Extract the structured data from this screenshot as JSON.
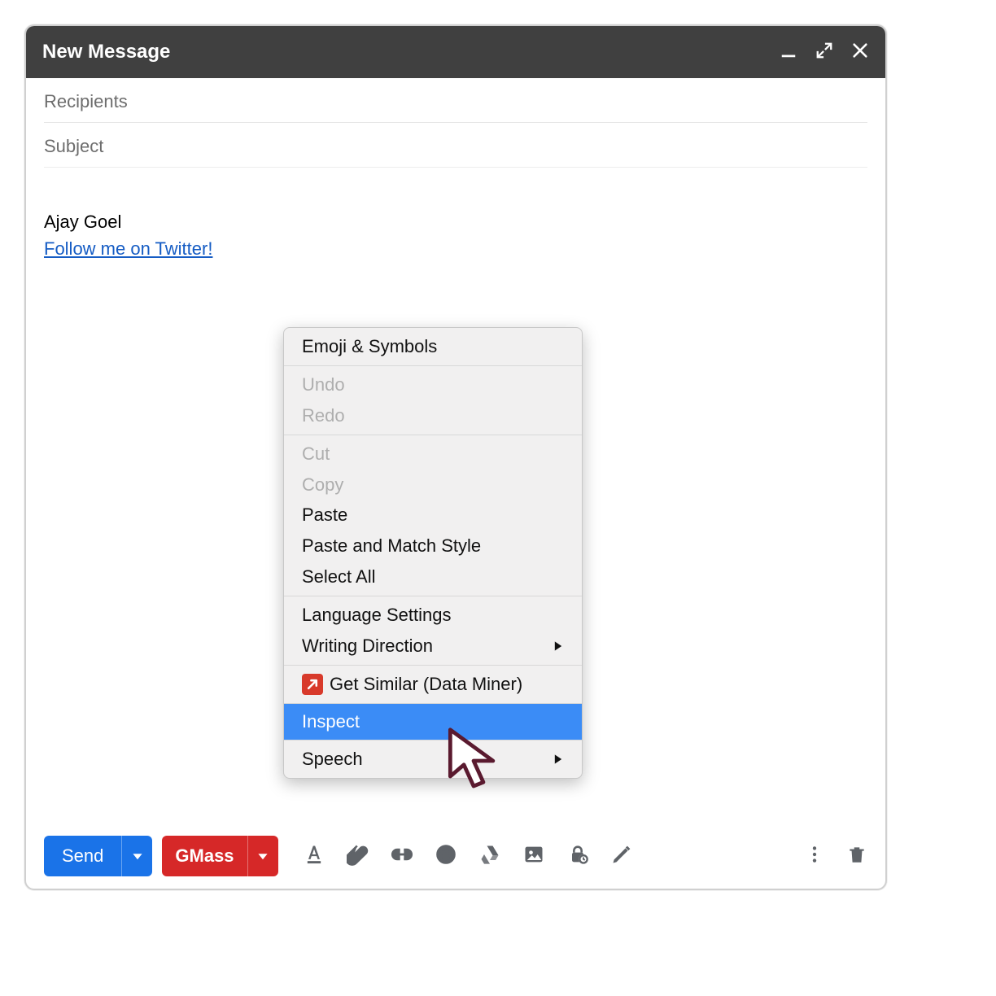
{
  "window": {
    "title": "New Message",
    "recipients_placeholder": "Recipients",
    "subject_placeholder": "Subject"
  },
  "signature": {
    "name": "Ajay Goel",
    "link_text": "Follow me on Twitter!"
  },
  "context_menu": {
    "groups": [
      {
        "items": [
          {
            "label": "Emoji & Symbols"
          }
        ]
      },
      {
        "items": [
          {
            "label": "Undo",
            "disabled": true
          },
          {
            "label": "Redo",
            "disabled": true
          }
        ]
      },
      {
        "items": [
          {
            "label": "Cut",
            "disabled": true
          },
          {
            "label": "Copy",
            "disabled": true
          },
          {
            "label": "Paste"
          },
          {
            "label": "Paste and Match Style"
          },
          {
            "label": "Select All"
          }
        ]
      },
      {
        "items": [
          {
            "label": "Language Settings"
          },
          {
            "label": "Writing Direction",
            "submenu": true
          }
        ]
      },
      {
        "items": [
          {
            "label": "Get Similar (Data Miner)",
            "icon": "miner"
          }
        ]
      },
      {
        "items": [
          {
            "label": "Inspect",
            "highlight": true
          }
        ]
      },
      {
        "items": [
          {
            "label": "Speech",
            "submenu": true
          }
        ]
      }
    ]
  },
  "toolbar": {
    "send_label": "Send",
    "gmass_label": "GMass",
    "icons": {
      "format": "format-text-icon",
      "attach": "attach-icon",
      "link": "link-icon",
      "emoji": "emoji-icon",
      "drive": "drive-icon",
      "image": "image-icon",
      "confidential": "confidential-icon",
      "pen": "pen-icon",
      "more": "more-icon",
      "trash": "trash-icon"
    }
  }
}
